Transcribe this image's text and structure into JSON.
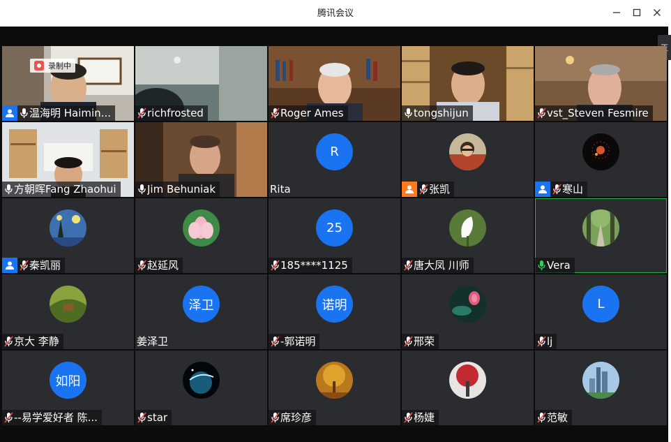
{
  "window": {
    "title": "腾讯会议",
    "side_tab": "正"
  },
  "colors": {
    "host_badge": "#1a73f0",
    "cohost_badge": "#ff7a1a",
    "muted_mic": "#e84b4b",
    "active_speaker": "#27b54a",
    "text_avatar": "#1a73f0"
  },
  "tiles": [
    {
      "name": "温海明 Haimin...",
      "mic": "on",
      "badge": "host",
      "type": "video",
      "recording": "录制中"
    },
    {
      "name": "richfrosted",
      "mic": "muted",
      "badge": "",
      "type": "video"
    },
    {
      "name": "Roger Ames",
      "mic": "muted",
      "badge": "",
      "type": "video"
    },
    {
      "name": "tongshijun",
      "mic": "on",
      "badge": "",
      "type": "video"
    },
    {
      "name": "vst_Steven Fesmire",
      "mic": "muted",
      "badge": "",
      "type": "video"
    },
    {
      "name": "方朝晖Fang Zhaohui",
      "mic": "on",
      "badge": "",
      "type": "video"
    },
    {
      "name": "Jim Behuniak",
      "mic": "on",
      "badge": "",
      "type": "video"
    },
    {
      "name": "Rita",
      "mic": "none",
      "badge": "",
      "type": "text",
      "avatar_text": "R"
    },
    {
      "name": "张凯",
      "mic": "muted",
      "badge": "cohost",
      "type": "image",
      "avatar_icon": "portrait-avatar-icon"
    },
    {
      "name": "寒山",
      "mic": "muted",
      "badge": "host",
      "type": "image",
      "avatar_icon": "fireworks-avatar-icon"
    },
    {
      "name": "秦凯丽",
      "mic": "muted",
      "badge": "host",
      "type": "image",
      "avatar_icon": "starry-night-avatar-icon"
    },
    {
      "name": "赵延风",
      "mic": "muted",
      "badge": "",
      "type": "image",
      "avatar_icon": "lotus-avatar-icon"
    },
    {
      "name": "185****1125",
      "mic": "muted",
      "badge": "",
      "type": "text",
      "avatar_text": "25"
    },
    {
      "name": "唐大凤  川师",
      "mic": "muted",
      "badge": "",
      "type": "image",
      "avatar_icon": "calla-lily-avatar-icon"
    },
    {
      "name": "Vera",
      "mic": "speaking",
      "badge": "",
      "type": "image",
      "avatar_icon": "forest-path-avatar-icon",
      "active": true
    },
    {
      "name": "京大 李静",
      "mic": "muted",
      "badge": "",
      "type": "image",
      "avatar_icon": "garden-avatar-icon"
    },
    {
      "name": "姜泽卫",
      "mic": "none",
      "badge": "",
      "type": "text",
      "avatar_text": "泽卫"
    },
    {
      "name": "-郭诺明",
      "mic": "muted",
      "badge": "",
      "type": "text",
      "avatar_text": "诺明"
    },
    {
      "name": "邢荣",
      "mic": "muted",
      "badge": "",
      "type": "image",
      "avatar_icon": "lotus-pond-avatar-icon"
    },
    {
      "name": "lj",
      "mic": "muted",
      "badge": "",
      "type": "text",
      "avatar_text": "L"
    },
    {
      "name": "--易学爱好者 陈...",
      "mic": "muted",
      "badge": "",
      "type": "text",
      "avatar_text": "如阳"
    },
    {
      "name": "star",
      "mic": "muted",
      "badge": "",
      "type": "image",
      "avatar_icon": "planet-avatar-icon"
    },
    {
      "name": "席珍彦",
      "mic": "muted",
      "badge": "",
      "type": "image",
      "avatar_icon": "autumn-tree-avatar-icon"
    },
    {
      "name": "杨婕",
      "mic": "muted",
      "badge": "",
      "type": "image",
      "avatar_icon": "red-tree-avatar-icon"
    },
    {
      "name": "范敏",
      "mic": "muted",
      "badge": "",
      "type": "image",
      "avatar_icon": "city-skyline-avatar-icon"
    }
  ]
}
